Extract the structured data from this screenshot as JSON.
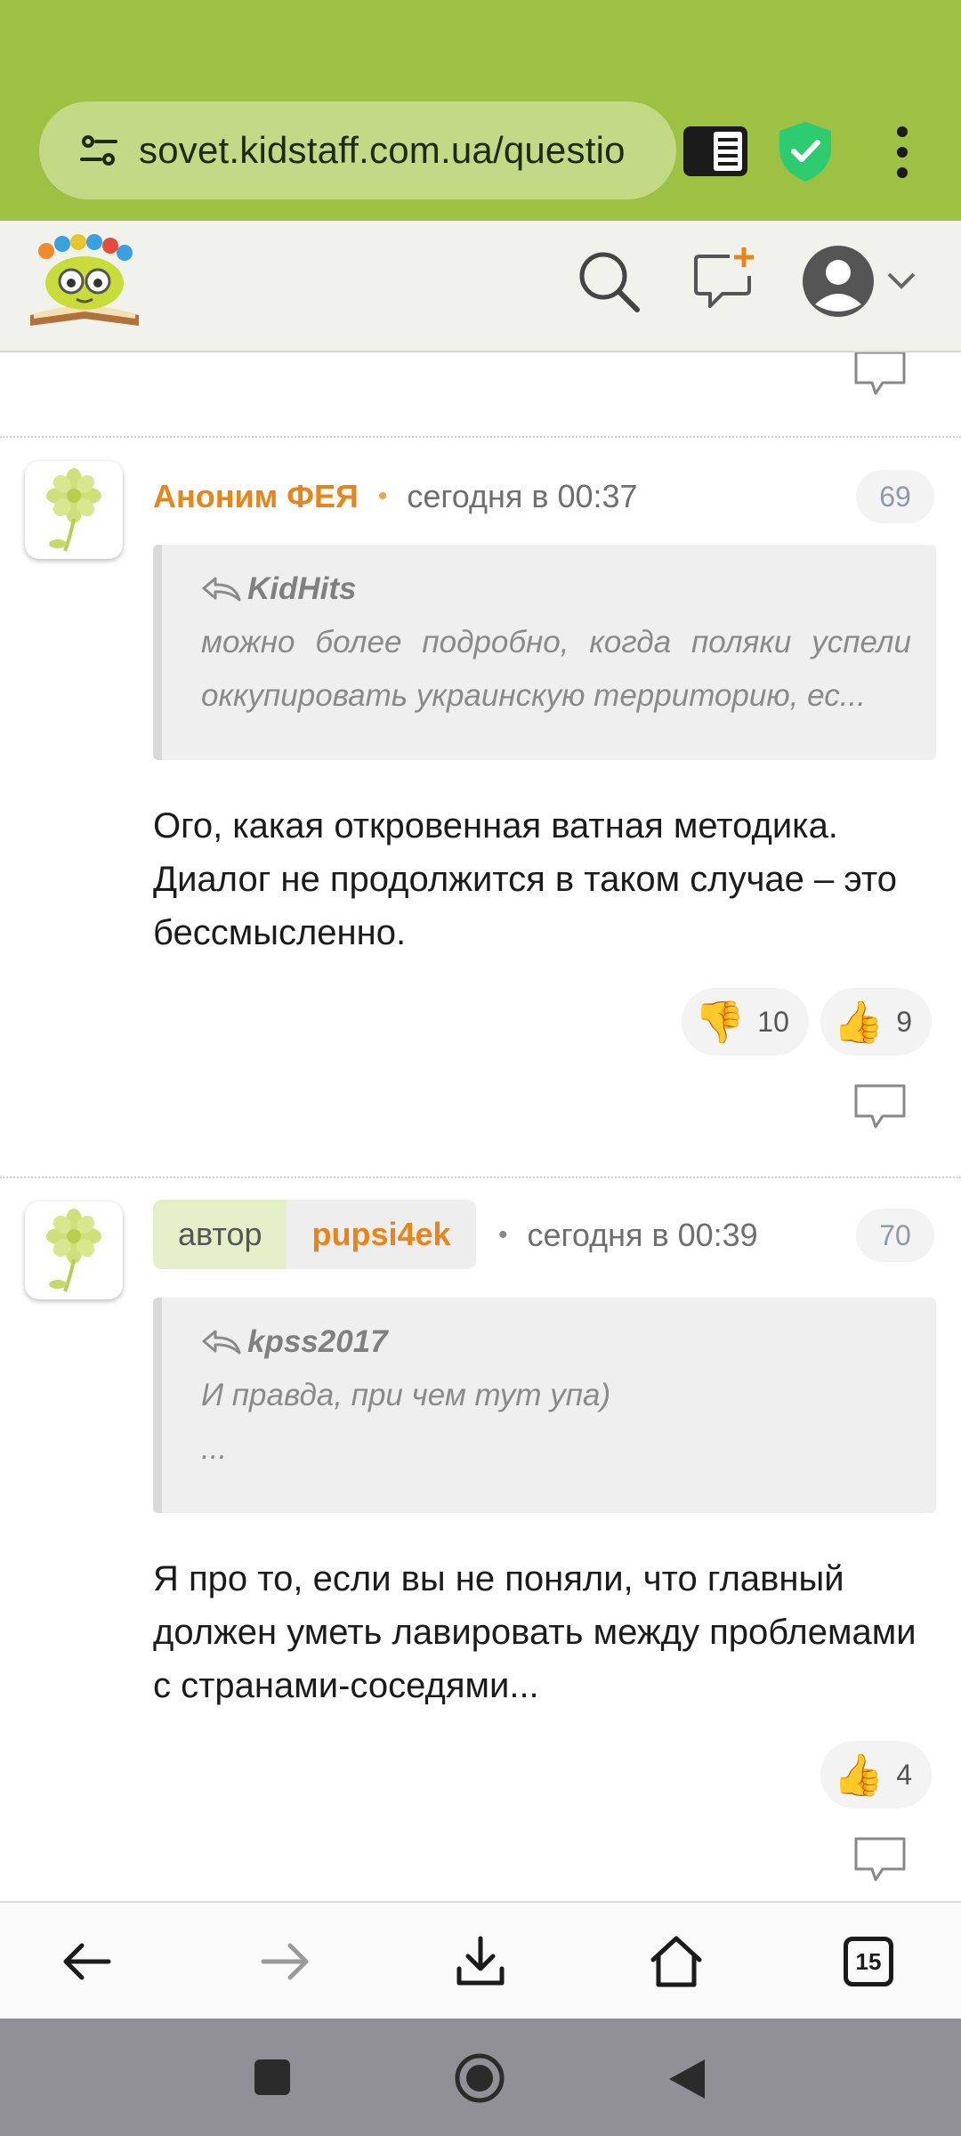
{
  "browser": {
    "url": "sovet.kidstaff.com.ua/questio",
    "shield_color": "#2ecc71"
  },
  "posts": [
    {
      "number": "69",
      "author": "Аноним ФЕЯ",
      "time": "сегодня в 00:37",
      "quote_author": "KidHits",
      "quote_text": "можно более подробно, когда поляки успели оккупировать украинскую территорию, ес...",
      "text": "Ого, какая откровенная ватная методика. Диалог не продолжится в таком случае – это бессмысленно.",
      "dislikes": "10",
      "likes": "9"
    },
    {
      "number": "70",
      "role_label": "автор",
      "author": "pupsi4ek",
      "time": "сегодня в 00:39",
      "quote_author": "kpss2017",
      "quote_line1": "И правда, при чем тут упа)",
      "quote_line2": "...",
      "text": "Я про то, если вы не поняли, что главный должен уметь лавировать между проблемами с странами-соседями...",
      "likes": "4"
    }
  ],
  "bottom_bar": {
    "tab_count": "15"
  },
  "icons": {
    "thumb_down": "👎",
    "thumb_up": "👍"
  }
}
